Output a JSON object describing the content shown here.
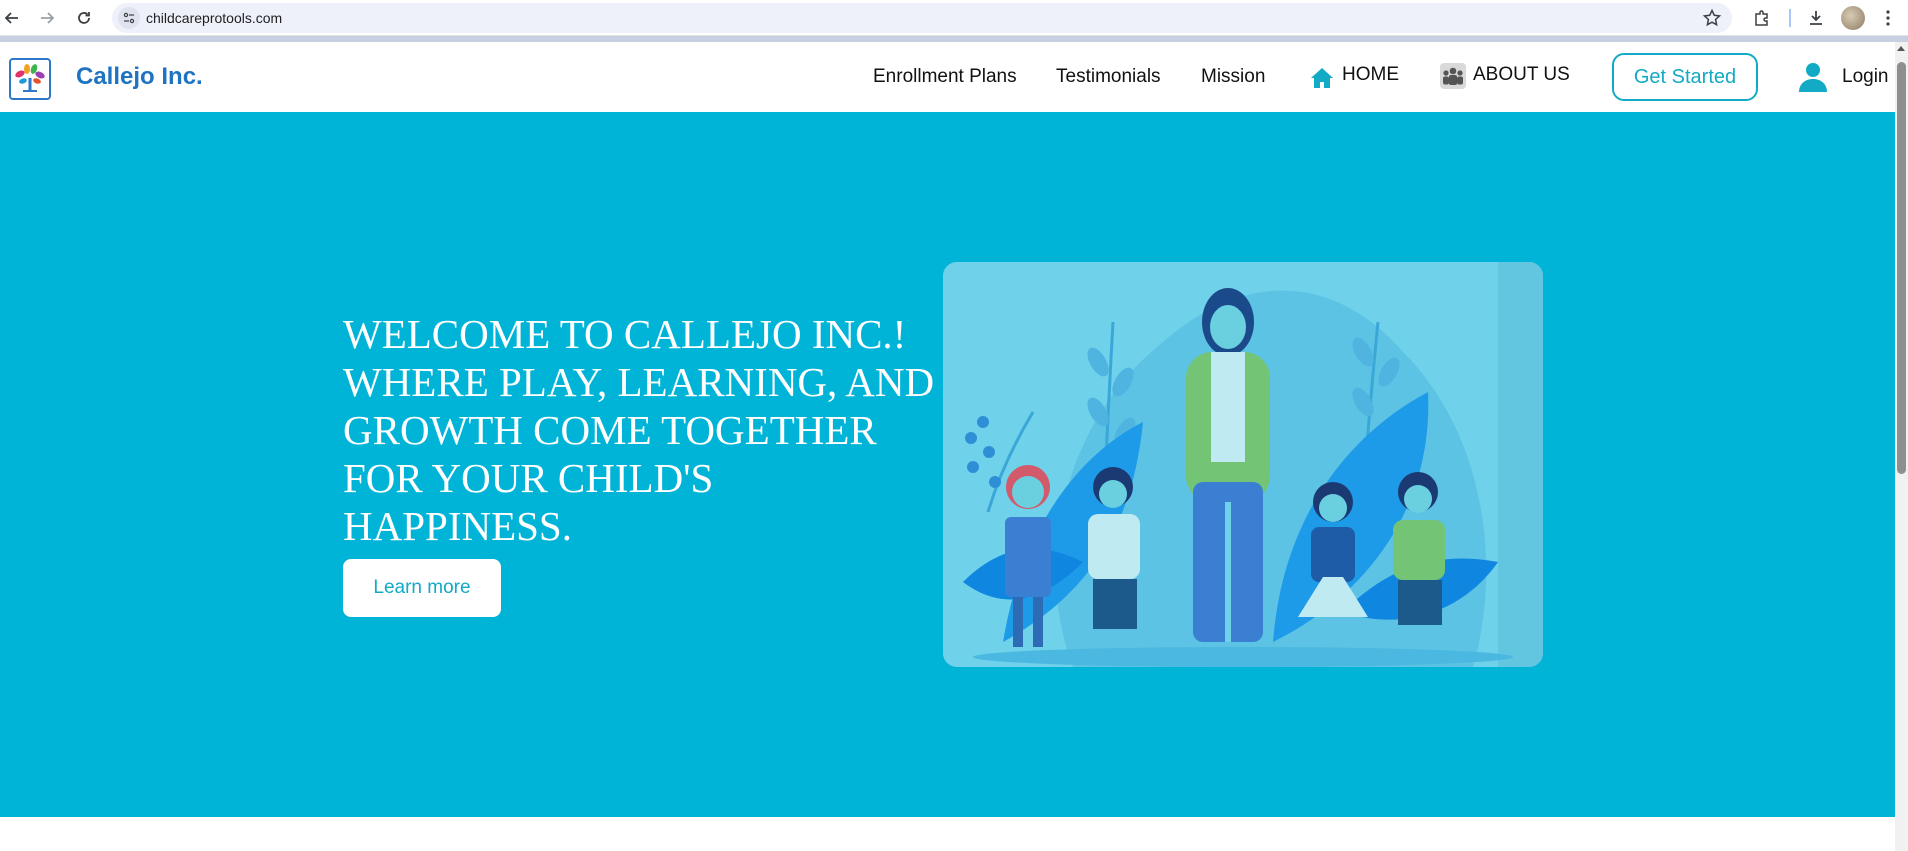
{
  "browser": {
    "url": "childcareprotools.com"
  },
  "header": {
    "brand": "Callejo Inc.",
    "nav": {
      "enrollment": "Enrollment Plans",
      "testimonials": "Testimonials",
      "mission": "Mission",
      "home": "HOME",
      "about": "ABOUT US"
    },
    "get_started": "Get Started",
    "login": "Login"
  },
  "hero": {
    "line1": "WELCOME TO CALLEJO INC.!",
    "line2": "WHERE PLAY, LEARNING, AND",
    "line3": "GROWTH COME TOGETHER",
    "line4": "FOR YOUR CHILD'S",
    "line5": "HAPPINESS.",
    "cta": "Learn more"
  },
  "colors": {
    "accent": "#00b4d8",
    "brand": "#1f73c3",
    "button_text": "#12aac5"
  },
  "icons": [
    "back-icon",
    "forward-icon",
    "reload-icon",
    "site-info-icon",
    "bookmark-star-icon",
    "extensions-icon",
    "download-icon",
    "menu-dots-icon",
    "home-icon",
    "group-icon",
    "user-icon"
  ]
}
